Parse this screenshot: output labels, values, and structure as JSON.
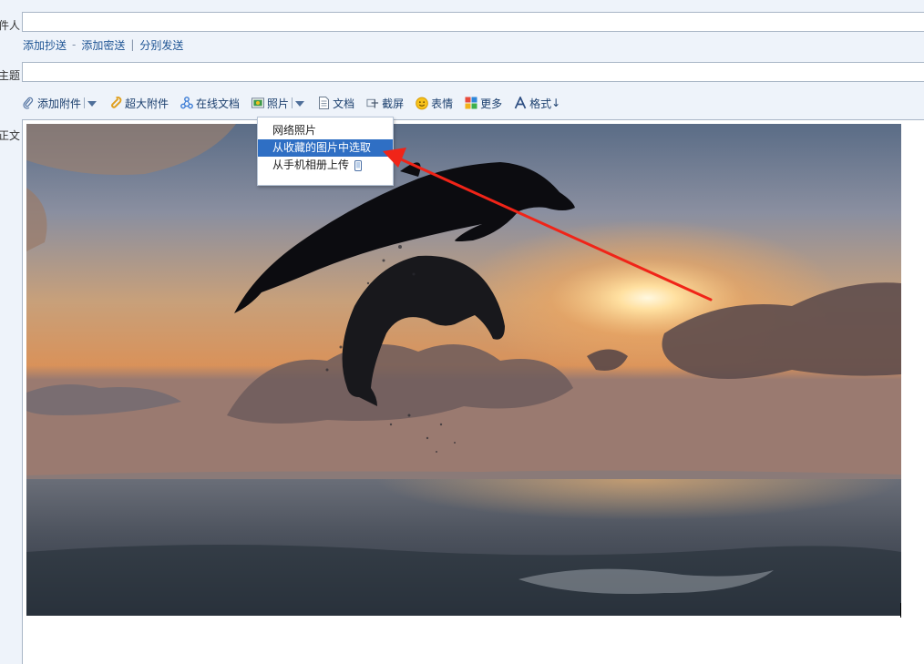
{
  "fields": {
    "recipient_label": "收件人",
    "subject_label": "主题",
    "body_label": "正文",
    "recipient_value": "",
    "subject_value": ""
  },
  "cc_links": {
    "add_cc": "添加抄送",
    "sep1": "-",
    "add_bcc": "添加密送",
    "sep2": "|",
    "separate_send": "分别发送"
  },
  "toolbar": {
    "attach": "添加附件",
    "big_attach": "超大附件",
    "online_doc": "在线文档",
    "photo": "照片",
    "doc": "文档",
    "screenshot": "截屏",
    "emoji": "表情",
    "more": "更多",
    "format": "格式",
    "format_suffix": "↓"
  },
  "photo_menu": {
    "items": [
      {
        "label": "网络照片"
      },
      {
        "label": "从收藏的图片中选取"
      },
      {
        "label": "从手机相册上传"
      }
    ],
    "highlighted_index": 1
  },
  "colors": {
    "link": "#1e5494",
    "menu_highlight": "#2f6fc4",
    "arrow": "#f02418"
  },
  "icons": {
    "attach": "paperclip-icon",
    "big_attach": "big-paperclip-icon",
    "online_doc": "share-nodes-icon",
    "photo": "picture-icon",
    "doc": "document-icon",
    "screenshot": "scissors-icon",
    "emoji": "smiley-icon",
    "more": "grid-icon",
    "format": "font-a-icon",
    "phone": "phone-icon"
  }
}
